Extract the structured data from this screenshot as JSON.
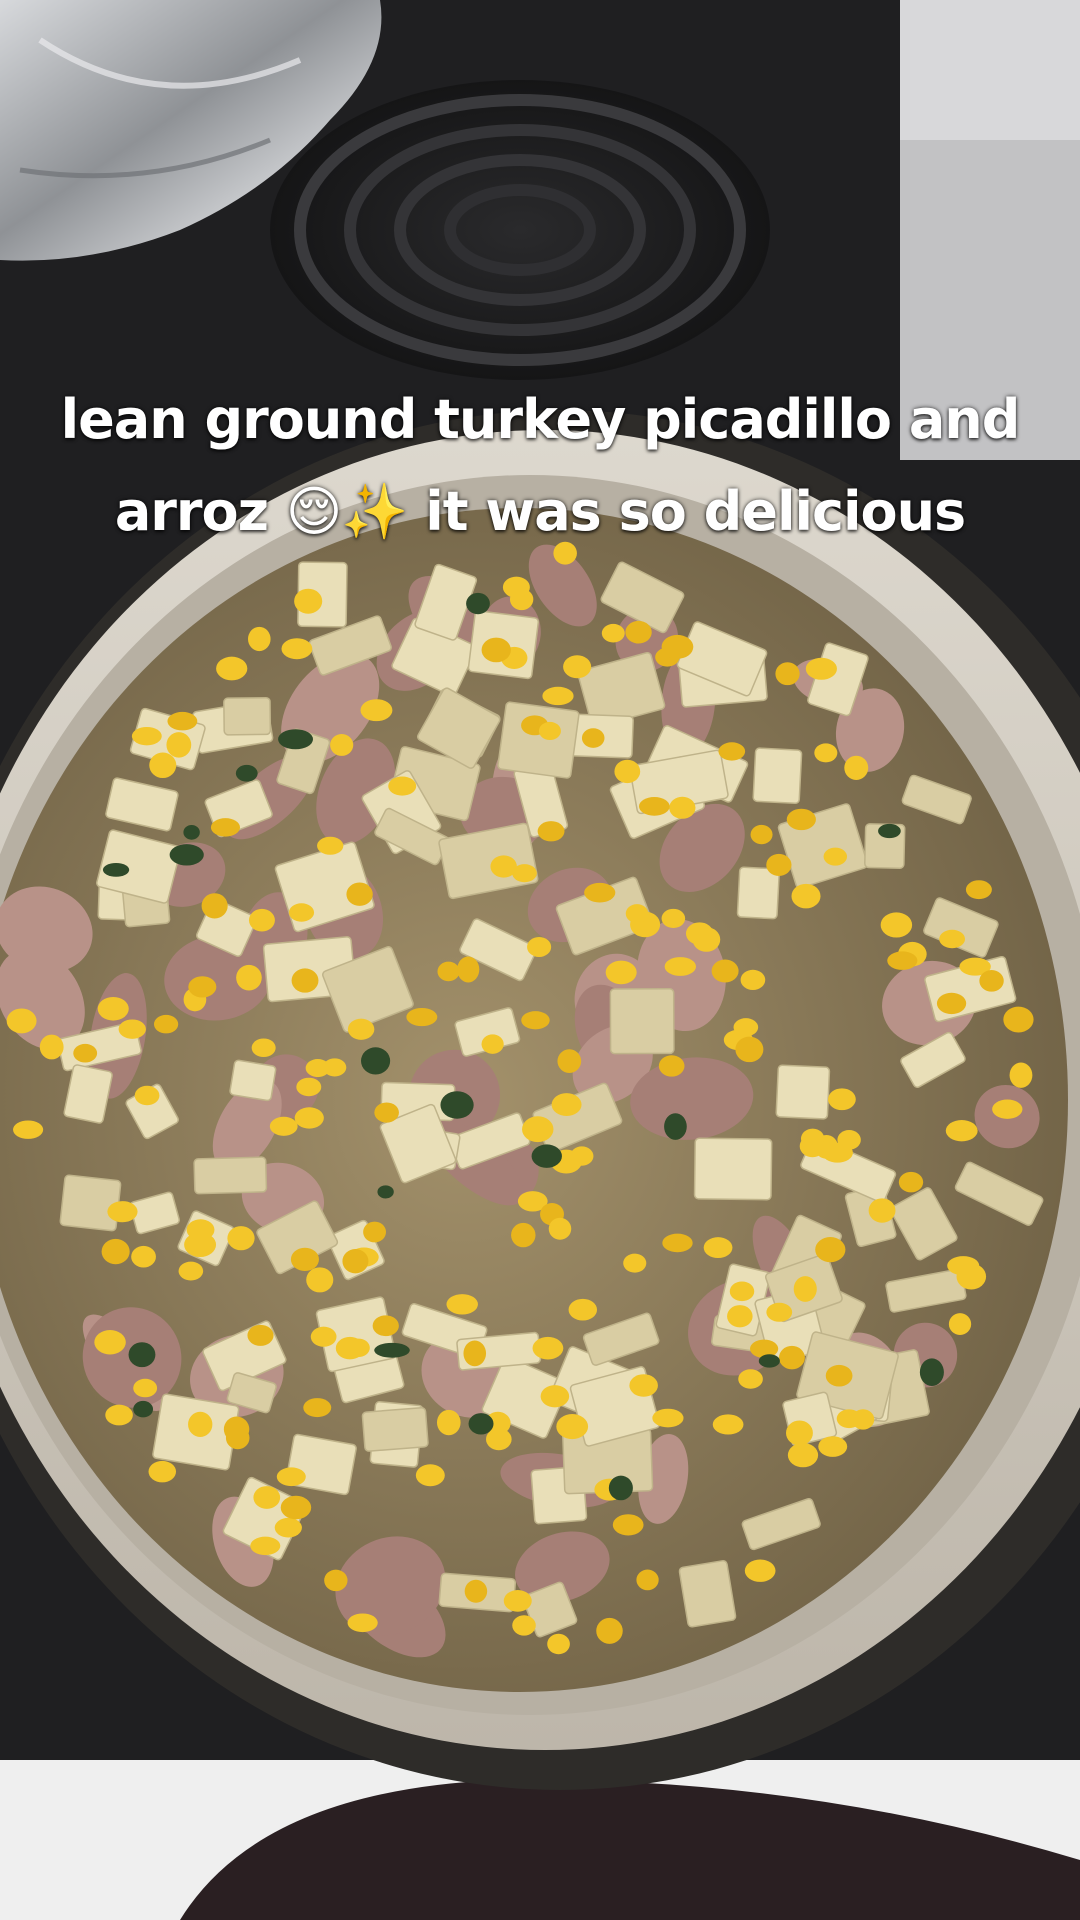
{
  "caption": {
    "line1": "lean ground turkey picadillo and",
    "line2_text1": "arroz",
    "line2_emoji1": "😌",
    "line2_emoji2": "✨",
    "line2_text2": "it was so delicious"
  },
  "colors": {
    "stove": "#1f1f21",
    "burner": "#2b2b2d",
    "foil": "#b8babd",
    "pan_rim": "#cfc9bf",
    "potato": "#e9dfb8",
    "turkey": "#b89288",
    "corn": "#f3c62a",
    "broth": "#8d7a50",
    "counter": "#f1f1f1"
  },
  "icons": [
    "foil-wrap",
    "stove-burner",
    "frying-pan",
    "face-emoji",
    "sparkles-emoji"
  ]
}
